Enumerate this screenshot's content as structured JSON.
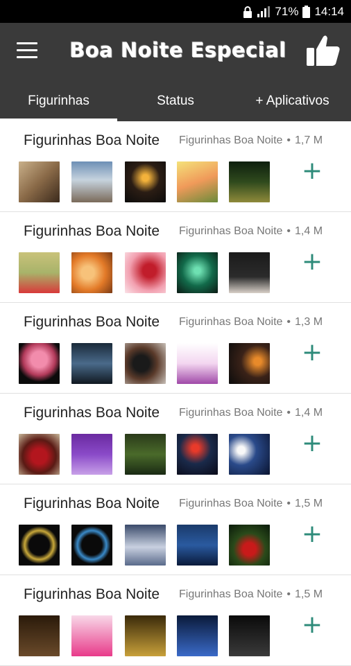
{
  "status_bar": {
    "battery": "71%",
    "time": "14:14"
  },
  "app_bar": {
    "title": "Boa Noite Especial"
  },
  "tabs": [
    {
      "label": "Figurinhas"
    },
    {
      "label": "Status"
    },
    {
      "label": "+ Aplicativos"
    }
  ],
  "packs": [
    {
      "title": "Figurinhas Boa Noite",
      "author": "Figurinhas Boa Noite",
      "size": "1,7 M",
      "add": "+"
    },
    {
      "title": "Figurinhas Boa Noite",
      "author": "Figurinhas Boa Noite",
      "size": "1,4 M",
      "add": "+"
    },
    {
      "title": "Figurinhas Boa Noite",
      "author": "Figurinhas Boa Noite",
      "size": "1,3 M",
      "add": "+"
    },
    {
      "title": "Figurinhas Boa Noite",
      "author": "Figurinhas Boa Noite",
      "size": "1,4 M",
      "add": "+"
    },
    {
      "title": "Figurinhas Boa Noite",
      "author": "Figurinhas Boa Noite",
      "size": "1,5 M",
      "add": "+"
    },
    {
      "title": "Figurinhas Boa Noite",
      "author": "Figurinhas Boa Noite",
      "size": "1,5 M",
      "add": "+"
    }
  ],
  "colors": {
    "app_bar": "#3a3a3a",
    "accent": "#2e8b7a"
  }
}
